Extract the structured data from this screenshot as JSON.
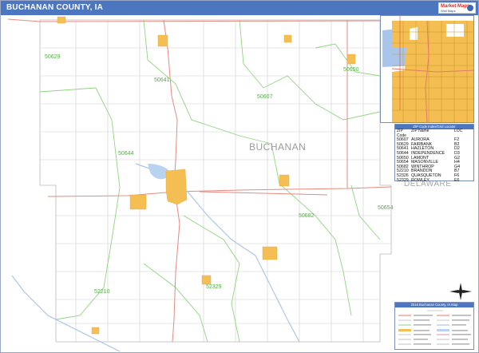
{
  "title": "BUCHANAN COUNTY, IA",
  "logo": {
    "line1": "Market Maps",
    "line2": "Wall Maps"
  },
  "map_labels": {
    "county_name": "BUCHANAN",
    "neighbor_county": "DELAWARE"
  },
  "zip_labels": [
    {
      "code": "50629"
    },
    {
      "code": "50641"
    },
    {
      "code": "50650"
    },
    {
      "code": "50607"
    },
    {
      "code": "50644"
    },
    {
      "code": "50682"
    },
    {
      "code": "50654"
    },
    {
      "code": "52210"
    },
    {
      "code": "52329"
    }
  ],
  "zip_index": {
    "title": "ZIP Code Index/Grid Locator",
    "columns": [
      "ZIP Code",
      "ZIP Name",
      "LOC"
    ],
    "rows": [
      {
        "zip": "50607",
        "name": "AURORA",
        "loc": "F2"
      },
      {
        "zip": "50629",
        "name": "FAIRBANK",
        "loc": "B2"
      },
      {
        "zip": "50641",
        "name": "HAZLETON",
        "loc": "D2"
      },
      {
        "zip": "50644",
        "name": "INDEPENDENCE",
        "loc": "D3"
      },
      {
        "zip": "50650",
        "name": "LAMONT",
        "loc": "G2"
      },
      {
        "zip": "50654",
        "name": "MASONVILLE",
        "loc": "H4"
      },
      {
        "zip": "50682",
        "name": "WINTHROP",
        "loc": "G4"
      },
      {
        "zip": "52210",
        "name": "BRANDON",
        "loc": "B7"
      },
      {
        "zip": "52326",
        "name": "QUASQUETON",
        "loc": "F6"
      },
      {
        "zip": "52329",
        "name": "ROWLEY",
        "loc": "E6"
      }
    ]
  },
  "legend": {
    "title": "2016 Buchanan County, IA Map"
  },
  "colors": {
    "title_bar": "#4d76c1",
    "city_fill": "#f5be52",
    "zip_boundary": "#7ccf6a",
    "highway": "#e07a6d",
    "water": "#a9c6ea",
    "road": "#c9c9c9",
    "label_green": "#5aa84d",
    "label_gray": "#9a9a9a"
  }
}
